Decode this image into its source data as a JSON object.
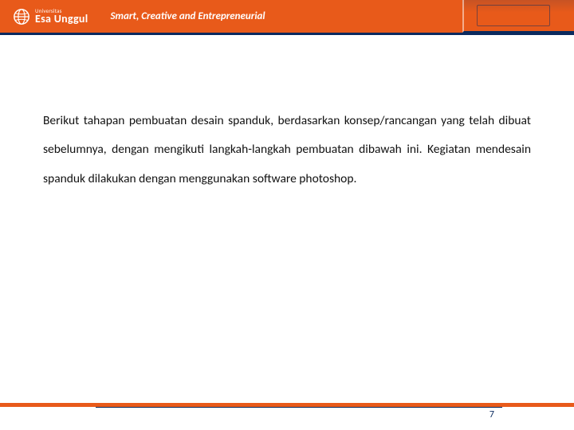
{
  "header": {
    "logo_sub": "Universitas",
    "logo_main": "Esa Unggul",
    "tagline": "Smart, Creative and Entrepreneurial"
  },
  "body": {
    "paragraph": "Berikut tahapan pembuatan desain spanduk, berdasarkan konsep/rancangan yang telah dibuat sebelumnya, dengan mengikuti langkah-langkah pembuatan dibawah ini. Kegiatan mendesain spanduk dilakukan dengan menggunakan software photoshop."
  },
  "footer": {
    "page_number": "7"
  },
  "colors": {
    "brand_orange": "#e85a1a",
    "brand_navy": "#0a2a5e"
  }
}
